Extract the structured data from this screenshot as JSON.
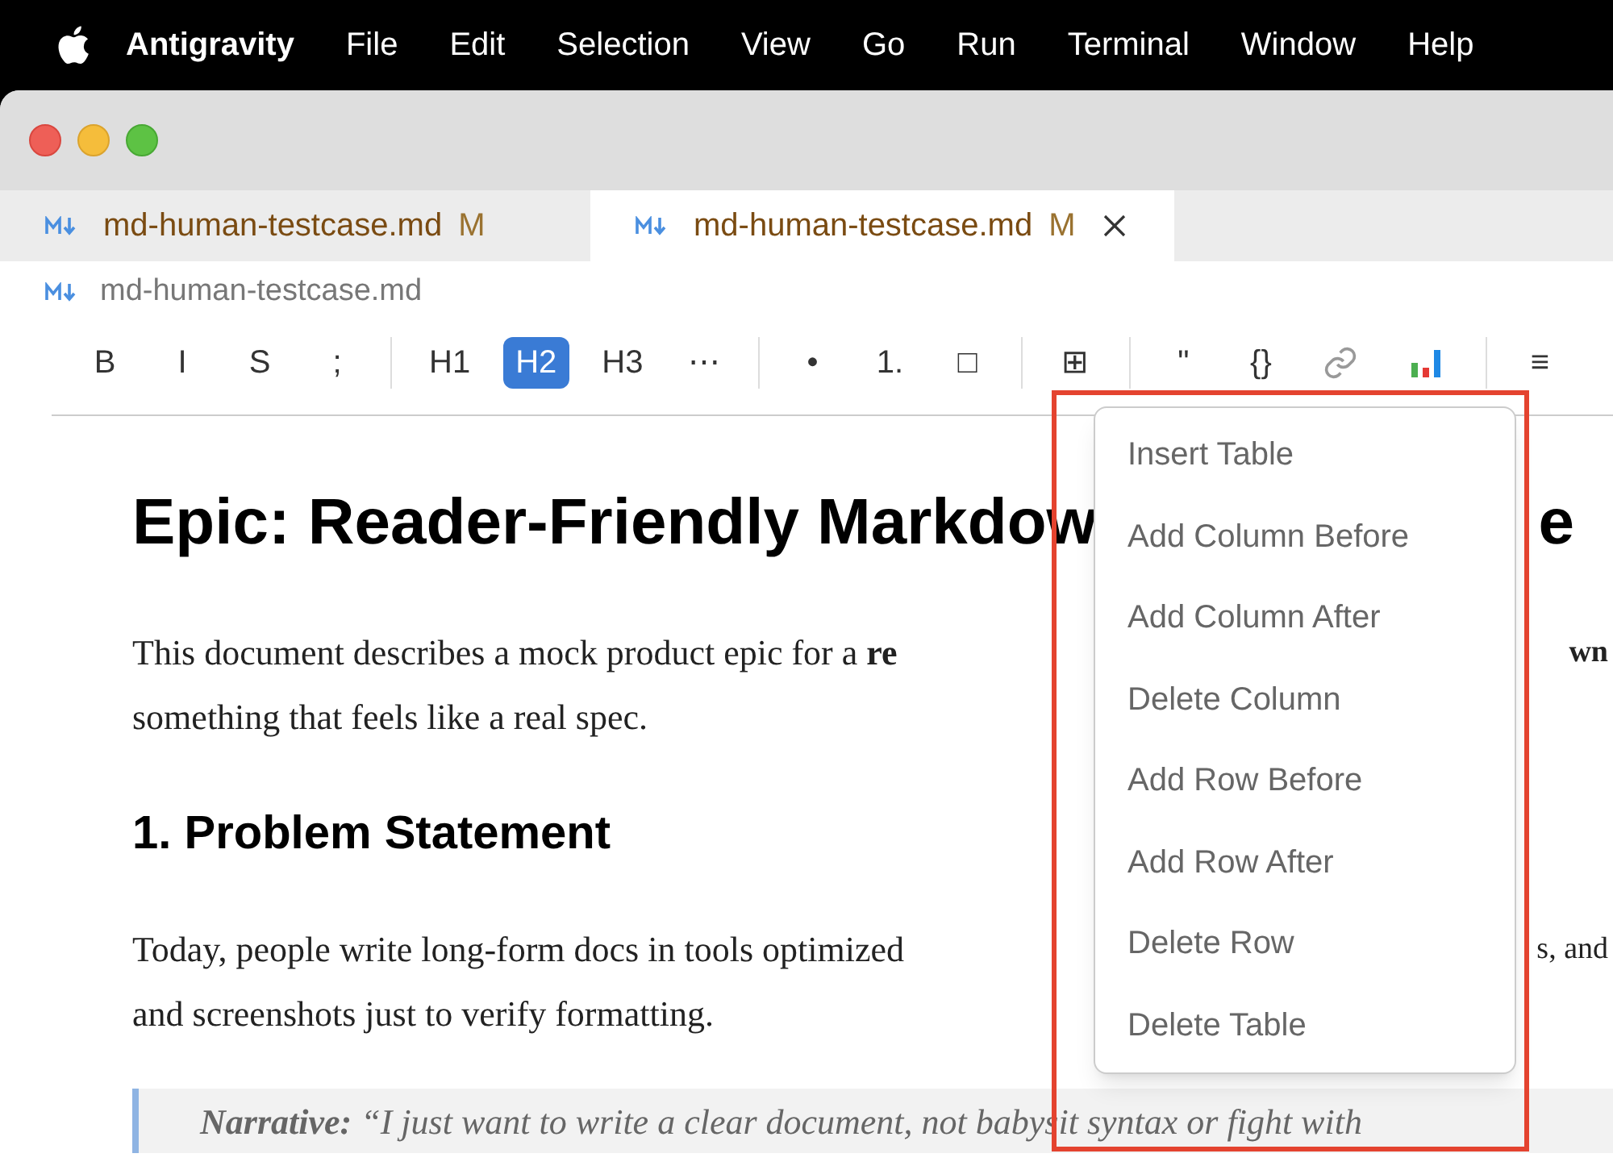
{
  "menu_bar": {
    "app": "Antigravity",
    "items": [
      "File",
      "Edit",
      "Selection",
      "View",
      "Go",
      "Run",
      "Terminal",
      "Window",
      "Help"
    ]
  },
  "tabs": [
    {
      "label": "md-human-testcase.md",
      "badge": "M",
      "selected": false
    },
    {
      "label": "md-human-testcase.md",
      "badge": "M",
      "selected": true
    }
  ],
  "breadcrumb": "md-human-testcase.md",
  "toolbar": [
    [
      {
        "kind": "text",
        "label": "B",
        "selected": false
      },
      {
        "kind": "text",
        "label": "I",
        "selected": false
      },
      {
        "kind": "text",
        "label": "S",
        "selected": false
      },
      {
        "kind": "text",
        "label": ";",
        "selected": false
      }
    ],
    [
      {
        "kind": "text",
        "label": "H1",
        "selected": false
      },
      {
        "kind": "text",
        "label": "H2",
        "selected": true
      },
      {
        "kind": "text",
        "label": "H3",
        "selected": false
      },
      {
        "kind": "text",
        "label": "⋯",
        "selected": false
      }
    ],
    [
      {
        "kind": "text",
        "label": "•",
        "selected": false
      },
      {
        "kind": "text",
        "label": "1.",
        "selected": false
      },
      {
        "kind": "text",
        "label": "□",
        "selected": false
      }
    ],
    [
      {
        "kind": "text",
        "label": "⊞",
        "selected": false
      }
    ],
    [
      {
        "kind": "text",
        "label": "\"",
        "selected": false
      },
      {
        "kind": "text",
        "label": "{}",
        "selected": false
      },
      {
        "kind": "link"
      },
      {
        "kind": "chart"
      }
    ],
    [
      {
        "kind": "text",
        "label": "≡",
        "selected": false
      }
    ]
  ],
  "document": [
    {
      "kind": "h1",
      "left": "Epic: Reader-Friendly Markdow",
      "right": "e"
    },
    {
      "kind": "p",
      "lines": [
        {
          "left": "This document describes a mock product epic for a **re**",
          "right": "wn",
          "right_bold": true
        },
        {
          "left": "something that feels like a real spec."
        }
      ]
    },
    {
      "kind": "h2",
      "left": "1. Problem Statement"
    },
    {
      "kind": "p",
      "lines": [
        {
          "left": "Today, people write long-form docs in tools optimized",
          "right": "s, and",
          "right_bold": false
        },
        {
          "left": "and screenshots just to verify formatting."
        }
      ]
    },
    {
      "kind": "quote",
      "label": "Narrative:",
      "text": "“I just want to write a clear document, not babysit syntax or fight with"
    }
  ],
  "context_menu": {
    "items": [
      "Insert Table",
      "Add Column Before",
      "Add Column After",
      "Delete Column",
      "Add Row Before",
      "Add Row After",
      "Delete Row",
      "Delete Table"
    ]
  },
  "annotation": {
    "kind": "highlight"
  }
}
